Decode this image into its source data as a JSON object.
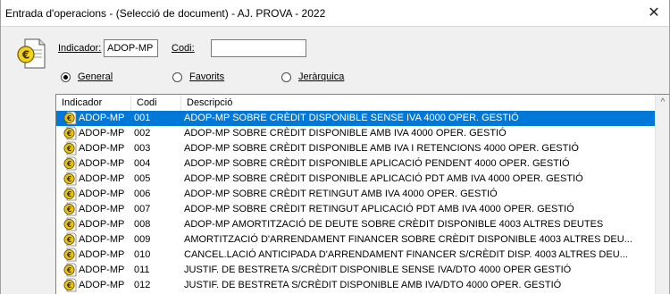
{
  "window": {
    "title": "Entrada d'operacions - (Selecció de document) - AJ. PROVA - 2022",
    "close_glyph": "✕"
  },
  "form": {
    "indicador_label": "Indicador:",
    "indicador_value": "ADOP-MP",
    "codi_label": "Codi:",
    "codi_value": ""
  },
  "view_options": [
    {
      "label": "General",
      "selected": true
    },
    {
      "label": "Favorits",
      "selected": false
    },
    {
      "label": "Jeràrquica",
      "selected": false
    }
  ],
  "table": {
    "columns": [
      "Indicador",
      "Codi",
      "Descripció"
    ],
    "selected_row": 0,
    "rows": [
      {
        "indicador": "ADOP-MP",
        "codi": "001",
        "descripcio": "ADOP-MP SOBRE CRÈDIT DISPONIBLE SENSE IVA 4000 OPER. GESTIÓ"
      },
      {
        "indicador": "ADOP-MP",
        "codi": "002",
        "descripcio": "ADOP-MP SOBRE CRÈDIT DISPONIBLE AMB IVA 4000 OPER. GESTIÓ"
      },
      {
        "indicador": "ADOP-MP",
        "codi": "003",
        "descripcio": "ADOP-MP SOBRE CRÈDIT DISPONIBLE AMB IVA I RETENCIONS 4000 OPER. GESTIÓ"
      },
      {
        "indicador": "ADOP-MP",
        "codi": "004",
        "descripcio": "ADOP-MP SOBRE CRÈDIT DISPONIBLE APLICACIÓ PENDENT 4000 OPER. GESTIÓ"
      },
      {
        "indicador": "ADOP-MP",
        "codi": "005",
        "descripcio": "ADOP-MP SOBRE CRÈDIT DISPONIBLE APLICACIÓ PDT AMB IVA 4000 OPER. GESTIÓ"
      },
      {
        "indicador": "ADOP-MP",
        "codi": "006",
        "descripcio": "ADOP-MP SOBRE CRÈDIT RETINGUT AMB IVA 4000 OPER. GESTIÓ"
      },
      {
        "indicador": "ADOP-MP",
        "codi": "007",
        "descripcio": "ADOP-MP SOBRE CRÈDIT RETINGUT APLICACIÓ PDT AMB IVA 4000 OPER. GESTIÓ"
      },
      {
        "indicador": "ADOP-MP",
        "codi": "008",
        "descripcio": "ADOP-MP AMORTITZACIÓ DE DEUTE SOBRE CRÈDIT DISPONIBLE 4003 ALTRES DEUTES"
      },
      {
        "indicador": "ADOP-MP",
        "codi": "009",
        "descripcio": "AMORTITZACIÓ D'ARRENDAMENT FINANCER SOBRE CRÈDIT DISPONIBLE 4003 ALTRES DEU..."
      },
      {
        "indicador": "ADOP-MP",
        "codi": "010",
        "descripcio": "CANCEL.LACIÓ ANTICIPADA D'ARRENDAMENT FINANCER S/CRÈDIT DISP. 4003 ALTRES DEU..."
      },
      {
        "indicador": "ADOP-MP",
        "codi": "011",
        "descripcio": "JUSTIF. DE BESTRETA S/CRÈDIT DISPONIBLE SENSE IVA/DTO 4000 OPER GESTIÓ"
      },
      {
        "indicador": "ADOP-MP",
        "codi": "012",
        "descripcio": "JUSTIF. DE BESTRETA S/CRÈDIT DISPONIBLE AMB IVA/DTO 4000 OPER. GESTIÓ"
      }
    ]
  },
  "scroll_up_glyph": "^",
  "icons": {
    "doc": "euro-document-icon",
    "row": "euro-coin-icon",
    "radio": "radio-button-icon"
  },
  "colors": {
    "selection": "#0078d7",
    "coin": "#e8c21a",
    "background": "#f0f0f0"
  }
}
